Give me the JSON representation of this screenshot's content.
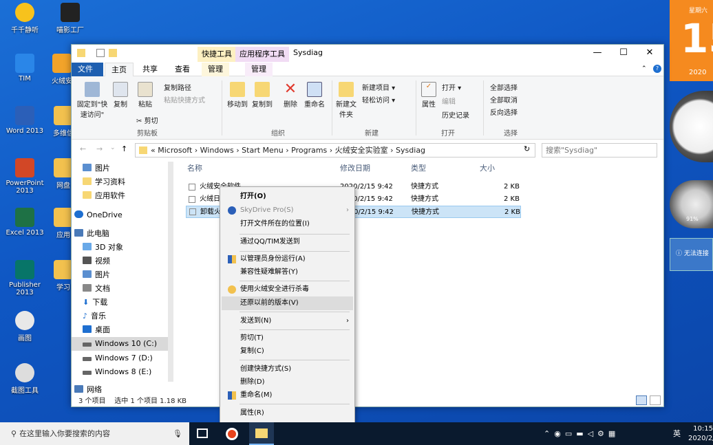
{
  "desktop": {
    "icons": [
      "千千静听",
      "喵影工厂",
      "TIM",
      "火绒安",
      "Word 2013",
      "多维信",
      "PowerPoint 2013",
      "网盘",
      "Excel 2013",
      "应用",
      "Publisher 2013",
      "学习",
      "画图",
      "截图工具"
    ]
  },
  "window": {
    "title": "Sysdiag",
    "context_tabs": [
      "快捷工具",
      "应用程序工具"
    ],
    "tabs": [
      "文件",
      "主页",
      "共享",
      "查看",
      "管理",
      "管理"
    ],
    "ribbon": {
      "pin": "固定到\"快速访问\"",
      "copy": "复制",
      "paste": "粘贴",
      "copy_path": "复制路径",
      "paste_shortcut": "粘贴快捷方式",
      "cut": "剪切",
      "group_clipboard": "剪贴板",
      "move_to": "移动到",
      "copy_to": "复制到",
      "delete": "删除",
      "rename": "重命名",
      "group_organize": "组织",
      "new_folder": "新建文件夹",
      "new_item": "新建项目",
      "easy_access": "轻松访问",
      "group_new": "新建",
      "properties": "属性",
      "open": "打开",
      "edit": "编辑",
      "history": "历史记录",
      "group_open": "打开",
      "select_all": "全部选择",
      "select_none": "全部取消",
      "invert": "反向选择",
      "group_select": "选择"
    },
    "address": {
      "path": "«  Microsoft  ›  Windows  ›  Start Menu  ›  Programs  ›  火绒安全实验室  ›  Sysdiag",
      "search_placeholder": "搜索\"Sysdiag\""
    },
    "nav": [
      "图片",
      "学习资料",
      "应用软件",
      "OneDrive",
      "此电脑",
      "3D 对象",
      "视频",
      "图片",
      "文档",
      "下载",
      "音乐",
      "桌面",
      "Windows 10 (C:)",
      "Windows 7 (D:)",
      "Windows 8 (E:)",
      "网络"
    ],
    "columns": [
      "名称",
      "修改日期",
      "类型",
      "大小"
    ],
    "files": [
      {
        "name": "火绒安全软件",
        "date": "2020/2/15 9:42",
        "type": "快捷方式",
        "size": "2 KB"
      },
      {
        "name": "火绒日",
        "date": "2020/2/15 9:42",
        "type": "快捷方式",
        "size": "2 KB"
      },
      {
        "name": "卸载火",
        "date": "2020/2/15 9:42",
        "type": "快捷方式",
        "size": "2 KB"
      }
    ],
    "status": {
      "count": "3 个项目",
      "selected": "选中 1 个项目  1.18 KB"
    }
  },
  "context_menu": [
    "打开(O)",
    "SkyDrive Pro(S)",
    "打开文件所在的位置(I)",
    "通过QQ/TIM发送到",
    "以管理员身份运行(A)",
    "兼容性疑难解答(Y)",
    "使用火绒安全进行杀毒",
    "还原以前的版本(V)",
    "发送到(N)",
    "剪切(T)",
    "复制(C)",
    "创建快捷方式(S)",
    "删除(D)",
    "重命名(M)",
    "属性(R)"
  ],
  "taskbar": {
    "search": "在这里输入你要搜索的内容",
    "lang": "英",
    "time": "10:15",
    "date": "2020/2/"
  },
  "widgets": {
    "cal_day": "15",
    "cal_week": "星期六",
    "cal_year": "2020",
    "gauge": "91%",
    "net": "无法连接"
  }
}
